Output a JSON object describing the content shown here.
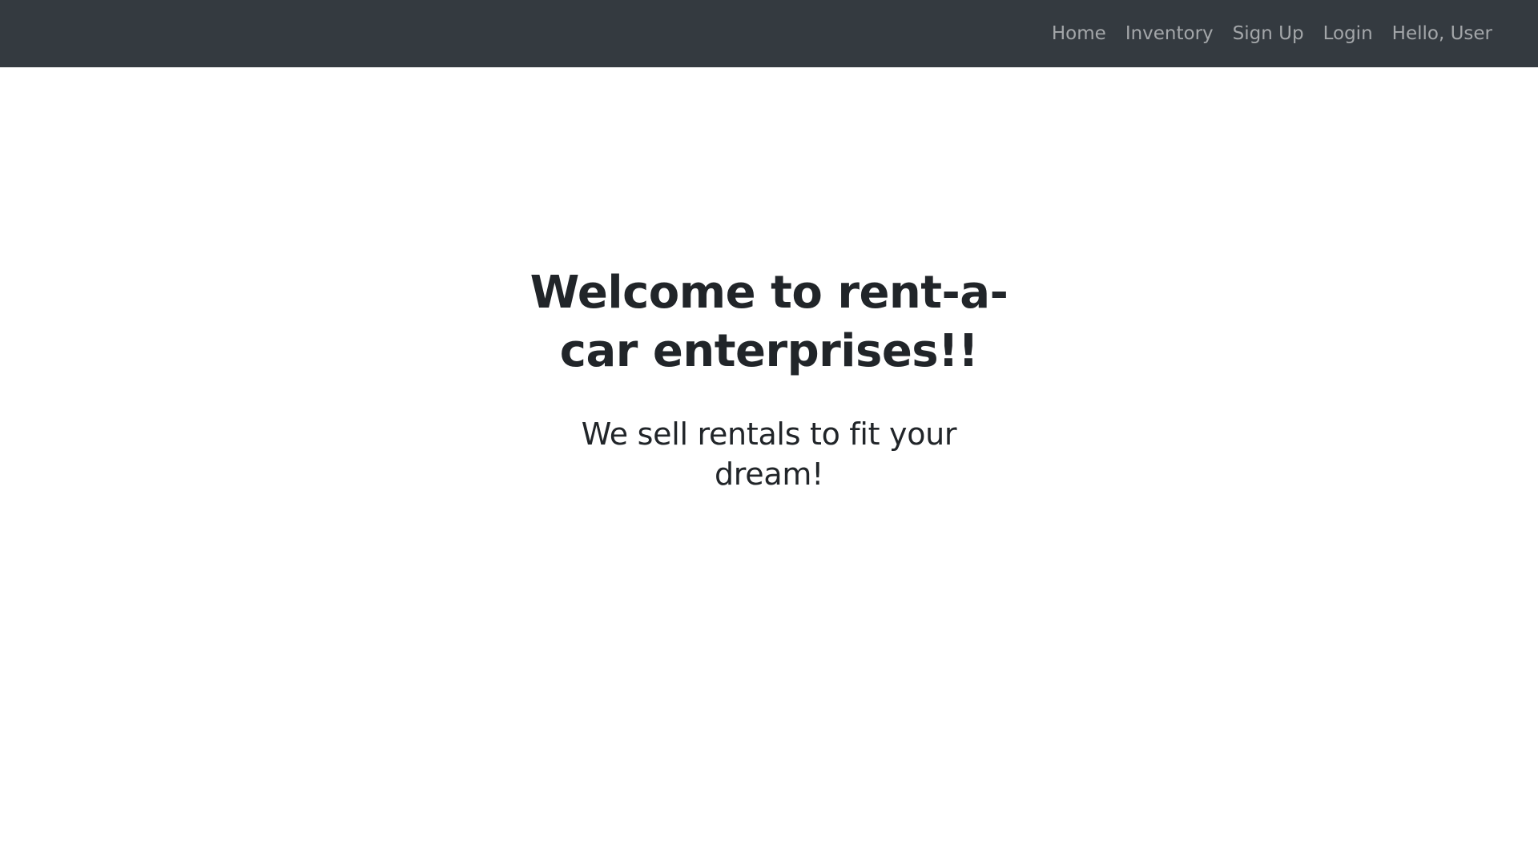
{
  "navbar": {
    "links": [
      {
        "label": "Home"
      },
      {
        "label": "Inventory"
      },
      {
        "label": "Sign Up"
      },
      {
        "label": "Login"
      },
      {
        "label": "Hello, User"
      }
    ]
  },
  "hero": {
    "title": "Welcome to rent-a-car enterprises!!",
    "subtitle": "We sell rentals to fit your dream!"
  },
  "colors": {
    "navbar_bg": "#343a40",
    "nav_link": "#9a9da0",
    "text": "#212529",
    "page_bg": "#ffffff"
  }
}
